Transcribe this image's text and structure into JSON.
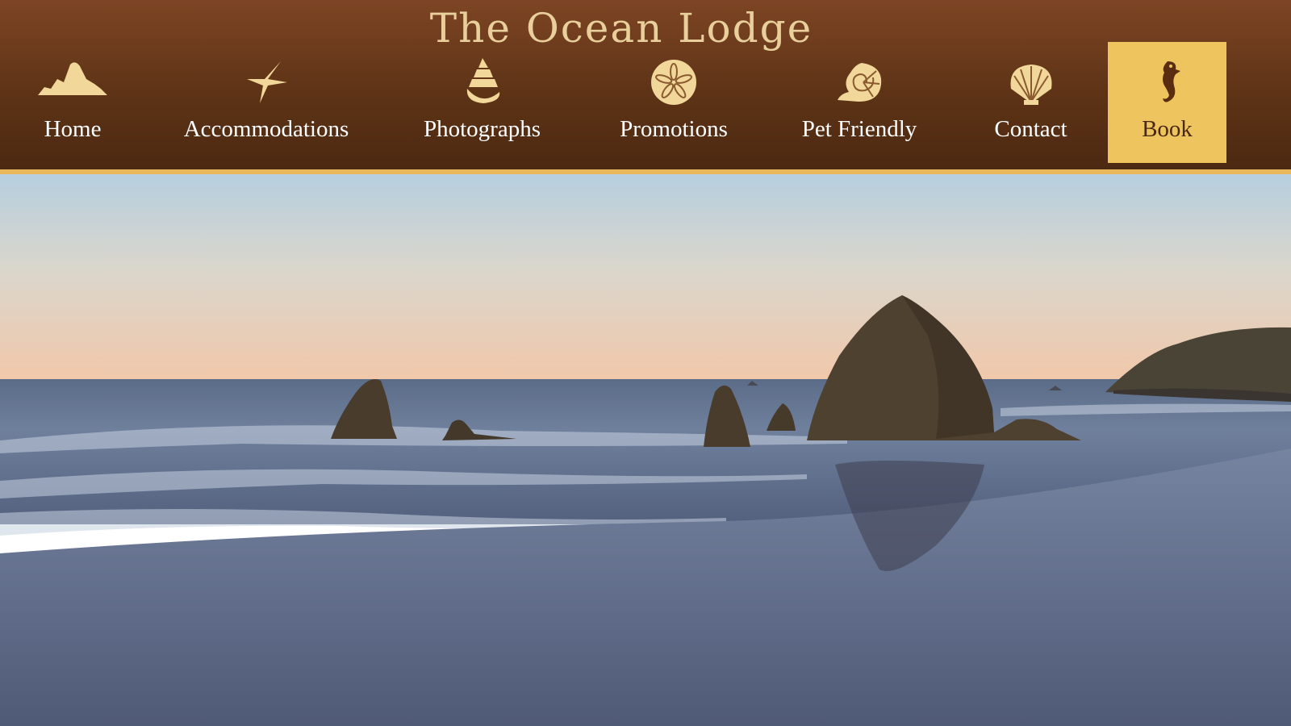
{
  "site": {
    "title": "The Ocean Lodge"
  },
  "nav": {
    "items": [
      {
        "label": "Home",
        "icon": "haystack-rock-icon"
      },
      {
        "label": "Accommodations",
        "icon": "starfish-icon"
      },
      {
        "label": "Photographs",
        "icon": "conch-shell-icon"
      },
      {
        "label": "Promotions",
        "icon": "sand-dollar-icon"
      },
      {
        "label": "Pet Friendly",
        "icon": "nautilus-shell-icon"
      },
      {
        "label": "Contact",
        "icon": "scallop-shell-icon"
      },
      {
        "label": "Book",
        "icon": "seahorse-icon"
      }
    ]
  },
  "colors": {
    "header_brown": "#5e3316",
    "accent_gold": "#eec45e",
    "icon_cream": "#f1d79a"
  }
}
